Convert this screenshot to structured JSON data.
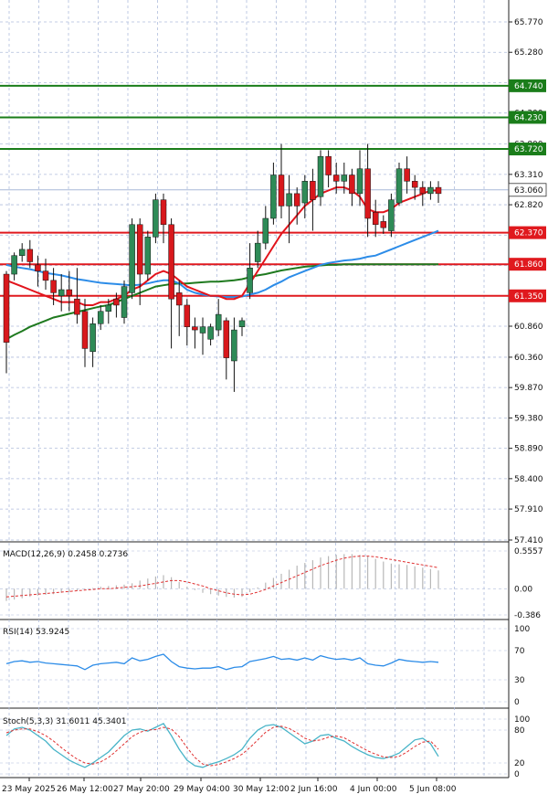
{
  "colors": {
    "up": "#2e8b57",
    "down": "#d8181c",
    "grid": "#b0bedc",
    "ma_red": "#e2141c",
    "ma_blue": "#2c8ce8",
    "ma_green": "#1f7a1f",
    "level_green": "#1a7d1a",
    "level_red": "#e0191e",
    "current_price_bg": "#ffffff",
    "signal": "#e03030",
    "stoch_k": "#48b4c8"
  },
  "chart_data": [
    {
      "type": "candlestick",
      "title": "",
      "ylim": [
        57.41,
        66.0
      ],
      "y_ticks": [
        "65.770",
        "65.280",
        "64.790",
        "64.300",
        "63.800",
        "63.310",
        "62.820",
        "62.330",
        "61.840",
        "61.350",
        "60.860",
        "60.360",
        "59.870",
        "59.380",
        "58.890",
        "58.400",
        "57.910",
        "57.410"
      ],
      "x_labels": [
        "23 May 2025",
        "26 May 12:00",
        "27 May 20:00",
        "29 May 04:00",
        "30 May 12:00",
        "2 Jun 16:00",
        "4 Jun 00:00",
        "5 Jun 08:00"
      ],
      "current_price": "63.060",
      "levels": [
        {
          "value": 64.74,
          "label": "64.740",
          "color": "green"
        },
        {
          "value": 64.23,
          "label": "64.230",
          "color": "green"
        },
        {
          "value": 63.72,
          "label": "63.720",
          "color": "green"
        },
        {
          "value": 62.37,
          "label": "62.370",
          "color": "red"
        },
        {
          "value": 61.86,
          "label": "61.860",
          "color": "red"
        },
        {
          "value": 61.35,
          "label": "61.350",
          "color": "red"
        }
      ],
      "candles": [
        [
          61.7,
          60.6,
          61.75,
          60.1
        ],
        [
          61.7,
          62.0,
          62.05,
          61.6
        ],
        [
          62.0,
          62.1,
          62.2,
          61.9
        ],
        [
          62.1,
          61.9,
          62.25,
          61.8
        ],
        [
          61.85,
          61.75,
          62.0,
          61.5
        ],
        [
          61.75,
          61.6,
          61.95,
          61.45
        ],
        [
          61.6,
          61.4,
          61.8,
          61.2
        ],
        [
          61.35,
          61.45,
          61.7,
          61.1
        ],
        [
          61.45,
          61.35,
          61.75,
          61.1
        ],
        [
          61.3,
          61.05,
          61.8,
          60.9
        ],
        [
          61.1,
          60.5,
          61.3,
          60.2
        ],
        [
          60.45,
          60.9,
          61.0,
          60.2
        ],
        [
          60.9,
          61.1,
          61.2,
          60.8
        ],
        [
          61.1,
          61.2,
          61.3,
          60.9
        ],
        [
          61.3,
          61.2,
          61.4,
          61.0
        ],
        [
          61.0,
          61.5,
          61.6,
          60.9
        ],
        [
          61.4,
          62.5,
          62.6,
          61.3
        ],
        [
          62.5,
          61.7,
          62.6,
          61.2
        ],
        [
          61.7,
          62.3,
          62.4,
          61.6
        ],
        [
          62.3,
          62.9,
          63.0,
          62.2
        ],
        [
          62.9,
          62.5,
          63.0,
          62.2
        ],
        [
          62.5,
          61.3,
          62.6,
          60.5
        ],
        [
          61.4,
          61.2,
          61.6,
          60.7
        ],
        [
          61.2,
          60.85,
          61.3,
          60.55
        ],
        [
          60.85,
          60.8,
          61.0,
          60.5
        ],
        [
          60.75,
          60.85,
          61.0,
          60.4
        ],
        [
          60.65,
          60.85,
          60.9,
          60.55
        ],
        [
          60.8,
          61.05,
          61.3,
          60.7
        ],
        [
          60.95,
          60.35,
          61.0,
          60.0
        ],
        [
          60.3,
          60.8,
          61.0,
          59.8
        ],
        [
          60.85,
          60.95,
          61.0,
          60.7
        ],
        [
          61.4,
          61.8,
          62.2,
          61.3
        ],
        [
          61.9,
          62.2,
          62.4,
          61.8
        ],
        [
          62.2,
          62.6,
          62.8,
          62.1
        ],
        [
          62.6,
          63.3,
          63.5,
          62.5
        ],
        [
          63.3,
          62.8,
          63.8,
          62.6
        ],
        [
          62.8,
          63.0,
          63.3,
          62.2
        ],
        [
          63.0,
          62.8,
          63.1,
          62.5
        ],
        [
          62.85,
          63.2,
          63.3,
          62.6
        ],
        [
          63.2,
          62.9,
          63.4,
          62.4
        ],
        [
          62.95,
          63.6,
          63.7,
          62.8
        ],
        [
          63.6,
          63.3,
          63.7,
          63.1
        ],
        [
          63.3,
          63.2,
          63.5,
          63.0
        ],
        [
          63.2,
          63.3,
          63.5,
          63.0
        ],
        [
          63.3,
          63.0,
          63.4,
          62.8
        ],
        [
          63.0,
          63.4,
          63.7,
          62.8
        ],
        [
          63.4,
          62.6,
          63.8,
          62.3
        ],
        [
          62.7,
          62.5,
          62.9,
          62.3
        ],
        [
          62.55,
          62.45,
          62.65,
          62.35
        ],
        [
          62.4,
          62.9,
          63.0,
          62.3
        ],
        [
          62.85,
          63.4,
          63.5,
          62.8
        ],
        [
          63.4,
          63.2,
          63.6,
          63.0
        ],
        [
          63.2,
          63.1,
          63.3,
          62.9
        ],
        [
          63.1,
          63.0,
          63.2,
          62.8
        ],
        [
          63.0,
          63.1,
          63.2,
          62.9
        ],
        [
          63.1,
          63.0,
          63.2,
          62.85
        ]
      ],
      "ma_red": [
        61.6,
        61.55,
        61.5,
        61.45,
        61.4,
        61.35,
        61.3,
        61.25,
        61.25,
        61.25,
        61.2,
        61.2,
        61.25,
        61.25,
        61.3,
        61.35,
        61.45,
        61.5,
        61.6,
        61.7,
        61.75,
        61.7,
        61.6,
        61.5,
        61.45,
        61.4,
        61.35,
        61.35,
        61.3,
        61.3,
        61.35,
        61.55,
        61.75,
        61.95,
        62.15,
        62.35,
        62.5,
        62.65,
        62.8,
        62.9,
        63.0,
        63.05,
        63.1,
        63.1,
        63.05,
        62.95,
        62.75,
        62.7,
        62.7,
        62.75,
        62.85,
        62.9,
        62.95,
        63.0,
        63.05,
        63.05
      ],
      "ma_blue": [
        61.85,
        61.82,
        61.8,
        61.78,
        61.75,
        61.72,
        61.7,
        61.68,
        61.65,
        61.62,
        61.6,
        61.58,
        61.56,
        61.55,
        61.54,
        61.53,
        61.52,
        61.53,
        61.55,
        61.58,
        61.6,
        61.6,
        61.55,
        61.45,
        61.4,
        61.37,
        61.35,
        61.34,
        61.33,
        61.33,
        61.34,
        61.37,
        61.4,
        61.45,
        61.52,
        61.58,
        61.65,
        61.7,
        61.75,
        61.8,
        61.85,
        61.88,
        61.9,
        61.92,
        61.93,
        61.95,
        61.98,
        62.0,
        62.05,
        62.1,
        62.15,
        62.2,
        62.25,
        62.3,
        62.35,
        62.4
      ],
      "ma_green": [
        60.65,
        60.72,
        60.78,
        60.85,
        60.9,
        60.95,
        61.0,
        61.03,
        61.06,
        61.09,
        61.12,
        61.15,
        61.18,
        61.2,
        61.25,
        61.3,
        61.35,
        61.4,
        61.45,
        61.5,
        61.52,
        61.54,
        61.55,
        61.55,
        61.56,
        61.57,
        61.58,
        61.58,
        61.59,
        61.6,
        61.62,
        61.65,
        61.68,
        61.7,
        61.73,
        61.76,
        61.78,
        61.8,
        61.82,
        61.83,
        61.84,
        61.85,
        61.85,
        61.86,
        61.86,
        61.86,
        61.86,
        61.86,
        61.86,
        61.86,
        61.86,
        61.86,
        61.86,
        61.86,
        61.86,
        61.86
      ]
    },
    {
      "type": "bar",
      "title": "MACD(12,26,9) 0.2458 0.2736",
      "ylim": [
        -0.386,
        0.5557
      ],
      "y_ticks": [
        "0.5557",
        "0.00",
        "-0.386"
      ],
      "values": [
        -0.18,
        -0.16,
        -0.14,
        -0.12,
        -0.1,
        -0.09,
        -0.08,
        -0.06,
        -0.05,
        -0.03,
        -0.01,
        0.01,
        0.03,
        0.04,
        0.05,
        0.06,
        0.08,
        0.12,
        0.15,
        0.18,
        0.2,
        0.17,
        0.1,
        0.03,
        -0.02,
        -0.06,
        -0.08,
        -0.1,
        -0.12,
        -0.13,
        -0.12,
        -0.05,
        0.02,
        0.09,
        0.16,
        0.22,
        0.28,
        0.34,
        0.38,
        0.42,
        0.46,
        0.48,
        0.5,
        0.51,
        0.51,
        0.5,
        0.48,
        0.44,
        0.4,
        0.37,
        0.36,
        0.35,
        0.33,
        0.31,
        0.29,
        0.27
      ],
      "signal": [
        -0.12,
        -0.11,
        -0.1,
        -0.09,
        -0.08,
        -0.07,
        -0.06,
        -0.05,
        -0.04,
        -0.03,
        -0.02,
        -0.01,
        0.0,
        0.0,
        0.01,
        0.02,
        0.03,
        0.04,
        0.06,
        0.08,
        0.1,
        0.12,
        0.12,
        0.1,
        0.07,
        0.04,
        0.0,
        -0.03,
        -0.06,
        -0.08,
        -0.09,
        -0.08,
        -0.05,
        -0.01,
        0.04,
        0.09,
        0.14,
        0.19,
        0.24,
        0.29,
        0.34,
        0.38,
        0.42,
        0.45,
        0.47,
        0.48,
        0.48,
        0.47,
        0.45,
        0.43,
        0.41,
        0.39,
        0.37,
        0.35,
        0.33,
        0.31
      ]
    },
    {
      "type": "line",
      "title": "RSI(14) 53.9245",
      "ylim": [
        0,
        100
      ],
      "y_ticks": [
        "100",
        "70",
        "30",
        "0"
      ],
      "values": [
        52,
        55,
        56,
        54,
        55,
        53,
        52,
        51,
        50,
        49,
        44,
        50,
        52,
        53,
        54,
        52,
        60,
        56,
        58,
        62,
        65,
        55,
        48,
        46,
        45,
        46,
        46,
        48,
        44,
        47,
        48,
        55,
        57,
        59,
        62,
        58,
        59,
        57,
        60,
        57,
        63,
        60,
        58,
        59,
        57,
        60,
        52,
        50,
        49,
        53,
        58,
        56,
        55,
        54,
        55,
        54
      ]
    },
    {
      "type": "line",
      "title": "Stoch(5,3,3) 31.6011 45.3401",
      "ylim": [
        0,
        100
      ],
      "y_ticks": [
        "100",
        "80",
        "20",
        "0"
      ],
      "k": [
        70,
        82,
        85,
        80,
        70,
        60,
        45,
        35,
        25,
        18,
        12,
        20,
        30,
        40,
        55,
        70,
        80,
        82,
        78,
        85,
        92,
        70,
        45,
        25,
        15,
        12,
        18,
        22,
        28,
        35,
        45,
        65,
        80,
        88,
        90,
        85,
        75,
        65,
        55,
        60,
        70,
        72,
        65,
        60,
        50,
        42,
        35,
        30,
        28,
        32,
        38,
        50,
        62,
        65,
        55,
        32
      ],
      "d": [
        75,
        80,
        82,
        82,
        77,
        70,
        60,
        48,
        37,
        27,
        20,
        18,
        22,
        30,
        42,
        55,
        68,
        76,
        80,
        81,
        85,
        82,
        68,
        48,
        30,
        18,
        15,
        17,
        22,
        28,
        36,
        48,
        62,
        76,
        85,
        87,
        83,
        75,
        65,
        60,
        62,
        67,
        69,
        66,
        58,
        50,
        42,
        36,
        31,
        30,
        32,
        40,
        50,
        58,
        60,
        45
      ]
    }
  ]
}
